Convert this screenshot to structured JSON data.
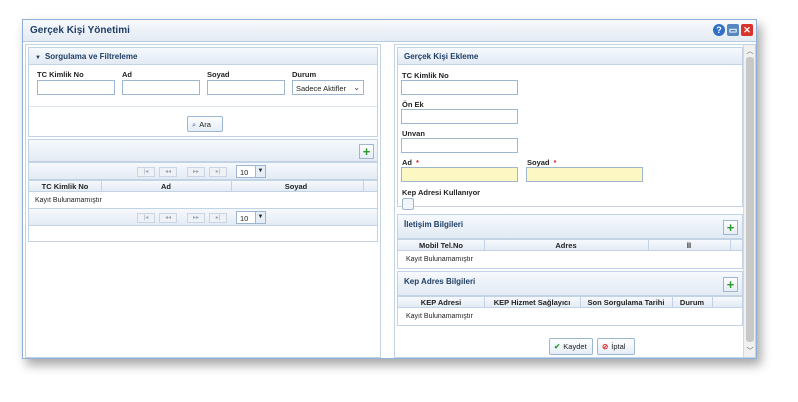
{
  "window": {
    "title": "Gerçek Kişi Yönetimi",
    "icons": [
      "help-icon",
      "monitor-icon",
      "close-icon"
    ]
  },
  "filter": {
    "header": "Sorgulama ve Filtreleme",
    "tc_label": "TC Kimlik No",
    "ad_label": "Ad",
    "soyad_label": "Soyad",
    "durum_label": "Durum",
    "durum_value": "Sadece Aktifler",
    "search_button": "Ara"
  },
  "results": {
    "page_size": "10",
    "columns": [
      "TC Kimlik No",
      "Ad",
      "Soyad"
    ],
    "empty_text": "Kayıt Bulunamamıştır",
    "pager_glyphs": {
      "first": "|◂",
      "prev": "◂◂",
      "next": "▸▸",
      "last": "▸|"
    }
  },
  "form": {
    "header": "Gerçek Kişi Ekleme",
    "tc_label": "TC Kimlik No",
    "onek_label": "Ön Ek",
    "unvan_label": "Unvan",
    "ad_label": "Ad",
    "soyad_label": "Soyad",
    "required_mark": "*",
    "kep_label": "Kep Adresi Kullanıyor"
  },
  "contact": {
    "header": "İletişim Bilgileri",
    "columns": [
      "Mobil Tel.No",
      "Adres",
      "İl"
    ],
    "empty_text": "Kayıt Bulunamamıştır"
  },
  "kep": {
    "header": "Kep Adres Bilgileri",
    "columns": [
      "KEP Adresi",
      "KEP Hizmet Sağlayıcı",
      "Son Sorgulama Tarihi",
      "Durum"
    ],
    "empty_text": "Kayıt Bulunamamıştır"
  },
  "actions": {
    "save": "Kaydet",
    "cancel": "İptal"
  },
  "colors": {
    "accent": "#1f3e66",
    "required": "#dd2222",
    "add_green": "#2e9a2e",
    "required_field": "#fdf7c3"
  }
}
